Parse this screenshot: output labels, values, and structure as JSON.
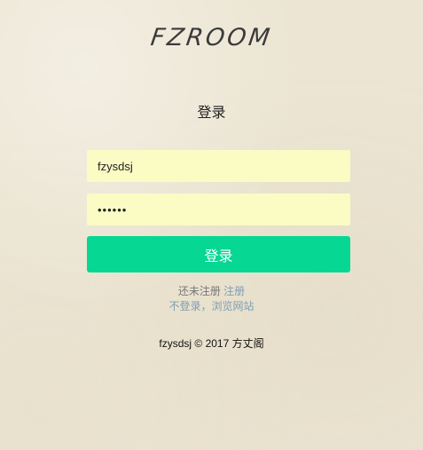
{
  "logo": {
    "text": "FZROOM"
  },
  "page_title": "登录",
  "form": {
    "username_value": "fzysdsj",
    "password_value": "••••••",
    "submit_label": "登录"
  },
  "links": {
    "no_account_text": "还未注册",
    "register_label": "注册",
    "browse_label": "不登录，浏览网站"
  },
  "footer": {
    "text": "fzysdsj © 2017 方丈阁"
  },
  "colors": {
    "background": "#ece5d3",
    "input_background": "#fafcc4",
    "button": "#06d793",
    "link": "#7f9db5"
  }
}
